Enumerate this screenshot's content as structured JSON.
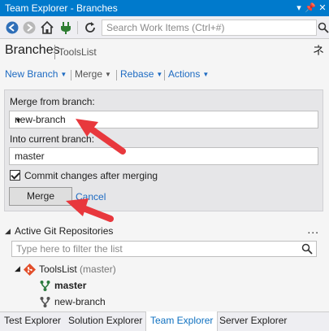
{
  "window": {
    "title": "Team Explorer - Branches"
  },
  "toolbar": {
    "search_placeholder": "Search Work Items (Ctrl+#)"
  },
  "header": {
    "title": "Branches",
    "context": "ToolsList",
    "extra_glyph": "ネ"
  },
  "actions": {
    "new_branch": "New Branch",
    "merge": "Merge",
    "rebase": "Rebase",
    "actions": "Actions"
  },
  "merge_panel": {
    "from_label": "Merge from branch:",
    "from_value": "new-branch",
    "into_label": "Into current branch:",
    "into_value": "master",
    "commit_label": "Commit changes after merging",
    "commit_checked": true,
    "merge_button": "Merge",
    "cancel_link": "Cancel"
  },
  "repos": {
    "section_title": "Active Git Repositories",
    "more_glyph": "...",
    "filter_placeholder": "Type here to filter the list",
    "repo_name": "ToolsList",
    "repo_branch_hint": "(master)",
    "branches": [
      "master",
      "new-branch"
    ]
  },
  "tabs": [
    "Test Explorer",
    "Solution Explorer",
    "Team Explorer",
    "Server Explorer"
  ],
  "colors": {
    "accent": "#007acc",
    "link": "#1e6bc2",
    "arrow": "#e8383d"
  }
}
